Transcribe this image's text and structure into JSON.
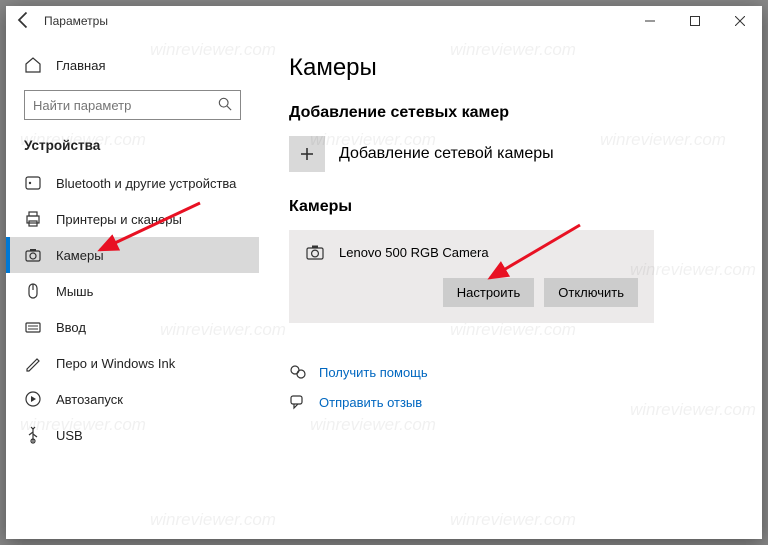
{
  "window": {
    "title": "Параметры"
  },
  "sidebar": {
    "home_label": "Главная",
    "search_placeholder": "Найти параметр",
    "category_label": "Устройства",
    "items": [
      {
        "label": "Bluetooth и другие устройства",
        "icon": "bluetooth-icon"
      },
      {
        "label": "Принтеры и сканеры",
        "icon": "printer-icon"
      },
      {
        "label": "Камеры",
        "icon": "camera-icon",
        "selected": true
      },
      {
        "label": "Мышь",
        "icon": "mouse-icon"
      },
      {
        "label": "Ввод",
        "icon": "keyboard-icon"
      },
      {
        "label": "Перо и Windows Ink",
        "icon": "pen-icon"
      },
      {
        "label": "Автозапуск",
        "icon": "autoplay-icon"
      },
      {
        "label": "USB",
        "icon": "usb-icon"
      }
    ]
  },
  "content": {
    "heading": "Камеры",
    "add_section_title": "Добавление сетевых камер",
    "add_label": "Добавление сетевой камеры",
    "cameras_section_title": "Камеры",
    "camera_name": "Lenovo 500 RGB Camera",
    "configure_label": "Настроить",
    "disable_label": "Отключить",
    "help_label": "Получить помощь",
    "feedback_label": "Отправить отзыв"
  },
  "watermark_text": "winreviewer.com"
}
